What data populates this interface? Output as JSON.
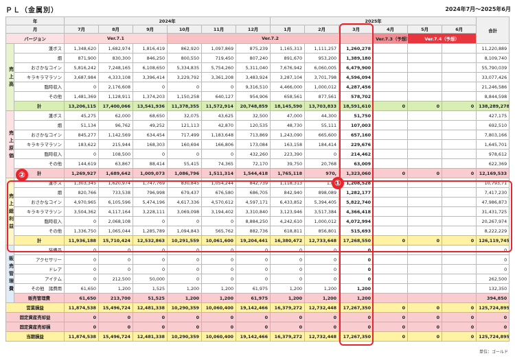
{
  "header": {
    "title": "ＰＬ（金属別）",
    "period": "2024年7月〜2025年6月"
  },
  "columns": {
    "nen_label": "年",
    "tsuki_label": "月",
    "version_label": "バージョン",
    "total_label": "合計",
    "years": [
      {
        "label": "2024年",
        "span": 6
      },
      {
        "label": "2025年",
        "span": 6
      }
    ],
    "months": [
      "7月",
      "8月",
      "9月",
      "10月",
      "11月",
      "12月",
      "1月",
      "2月",
      "3月",
      "4月",
      "5月",
      "6月"
    ],
    "versions": [
      {
        "label": "Ver.7.1",
        "span": 3,
        "cls": "v71"
      },
      {
        "label": "Ver.7.2",
        "span": 6,
        "cls": "v72"
      },
      {
        "label": "Ver.7.3（予想）",
        "span": 1,
        "cls": "v73"
      },
      {
        "label": "Ver.7.4（予想）",
        "span": 2,
        "cls": "v74"
      }
    ]
  },
  "sections": [
    {
      "label": "売上高",
      "style": "g-blk",
      "rows": [
        {
          "name": "蓬ボス",
          "values": [
            "1,348,620",
            "1,682,974",
            "1,816,419",
            "862,920",
            "1,097,869",
            "875,239",
            "1,165,313",
            "1,111,257",
            "1,260,278",
            "",
            "",
            ""
          ],
          "total": "11,220,889"
        },
        {
          "name": "烟",
          "values": [
            "871,900",
            "830,300",
            "846,250",
            "800,550",
            "719,450",
            "807,240",
            "891,670",
            "953,200",
            "1,389,180",
            "",
            "",
            ""
          ],
          "total": "8,109,740"
        },
        {
          "name": "おさかなコイン",
          "values": [
            "5,816,242",
            "7,248,165",
            "6,108,650",
            "5,334,835",
            "5,754,260",
            "5,311,040",
            "7,676,942",
            "6,060,005",
            "6,479,900",
            "",
            "",
            ""
          ],
          "total": "55,790,039"
        },
        {
          "name": "キラキラマラソン",
          "values": [
            "3,687,984",
            "4,333,108",
            "3,396,414",
            "3,229,792",
            "3,361,208",
            "3,483,924",
            "3,287,104",
            "3,701,798",
            "4,596,094",
            "",
            "",
            ""
          ],
          "total": "33,077,426"
        },
        {
          "name": "臨時収入",
          "values": [
            "0",
            "2,176,608",
            "0",
            "0",
            "0",
            "9,316,510",
            "4,466,000",
            "1,000,012",
            "4,287,456",
            "",
            "",
            ""
          ],
          "total": "21,246,586"
        },
        {
          "name": "その他",
          "values": [
            "1,481,369",
            "1,128,911",
            "1,374,203",
            "1,150,258",
            "640,127",
            "954,906",
            "658,561",
            "877,561",
            "578,702",
            "",
            "",
            ""
          ],
          "total": "8,844,598"
        }
      ],
      "total": {
        "name": "計",
        "values": [
          "13,206,115",
          "17,400,066",
          "13,541,936",
          "11,378,355",
          "11,572,914",
          "20,748,859",
          "18,145,590",
          "13,703,833",
          "18,591,610",
          "0",
          "0",
          "0"
        ],
        "total": "138,289,278"
      }
    },
    {
      "label": "売上原価",
      "style": "p-blk",
      "rows": [
        {
          "name": "蓬ボス",
          "values": [
            "45,275",
            "62,000",
            "68,650",
            "32,075",
            "43,625",
            "32,500",
            "47,000",
            "44,300",
            "51,750",
            "",
            "",
            ""
          ],
          "total": "427,175"
        },
        {
          "name": "烟",
          "values": [
            "51,134",
            "96,762",
            "49,252",
            "121,113",
            "42,870",
            "120,535",
            "48,730",
            "55,111",
            "107,003",
            "",
            "",
            ""
          ],
          "total": "692,510"
        },
        {
          "name": "おさかなコイン",
          "values": [
            "845,277",
            "1,142,569",
            "634,454",
            "717,499",
            "1,183,648",
            "713,869",
            "1,243,090",
            "665,600",
            "657,160",
            "",
            "",
            ""
          ],
          "total": "7,803,166"
        },
        {
          "name": "キラキラマラソン",
          "values": [
            "183,622",
            "215,944",
            "168,303",
            "160,694",
            "166,806",
            "173,084",
            "163,158",
            "184,414",
            "229,676",
            "",
            "",
            ""
          ],
          "total": "1,645,701"
        },
        {
          "name": "臨時収入",
          "values": [
            "0",
            "108,500",
            "0",
            "0",
            "0",
            "432,260",
            "223,390",
            "0",
            "214,462",
            "",
            "",
            ""
          ],
          "total": "978,612"
        },
        {
          "name": "その他",
          "values": [
            "144,619",
            "63,867",
            "88,414",
            "55,415",
            "74,365",
            "72,170",
            "39,750",
            "20,768",
            "63,009",
            "",
            "",
            ""
          ],
          "total": "622,369"
        }
      ],
      "total": {
        "name": "計",
        "values": [
          "1,269,927",
          "1,689,642",
          "1,009,073",
          "1,086,796",
          "1,511,314",
          "1,544,418",
          "1,765,118",
          "970,",
          "1,323,060",
          "0",
          "0",
          "0"
        ],
        "total": "12,169,533"
      }
    },
    {
      "label": "売上総利益",
      "style": "y-blk",
      "rows": [
        {
          "name": "蓬ボス",
          "values": [
            "1,303,345",
            "1,620,974",
            "1,747,769",
            "830,845",
            "1,054,244",
            "842,739",
            "1,118,313",
            "1,06",
            "1,208,528",
            "",
            "",
            ""
          ],
          "total": "10,793,71"
        },
        {
          "name": "烟",
          "values": [
            "820,766",
            "733,538",
            "796,998",
            "679,437",
            "676,580",
            "686,705",
            "842,940",
            "898,089",
            "1,282,177",
            "",
            "",
            ""
          ],
          "total": "7,417,230"
        },
        {
          "name": "おさかなコイン",
          "values": [
            "4,970,965",
            "6,105,596",
            "5,474,196",
            "4,617,336",
            "4,570,612",
            "4,597,171",
            "6,433,852",
            "5,394,405",
            "5,822,740",
            "",
            "",
            ""
          ],
          "total": "47,986,873"
        },
        {
          "name": "キラキラマラソン",
          "values": [
            "3,504,362",
            "4,117,164",
            "3,228,111",
            "3,069,098",
            "3,194,402",
            "3,310,840",
            "3,123,946",
            "3,517,384",
            "4,366,418",
            "",
            "",
            ""
          ],
          "total": "31,431,725"
        },
        {
          "name": "臨時収入",
          "values": [
            "0",
            "2,068,108",
            "0",
            "0",
            "0",
            "8,884,250",
            "4,242,610",
            "1,000,012",
            "4,072,994",
            "",
            "",
            ""
          ],
          "total": "20,267,974"
        },
        {
          "name": "その他",
          "values": [
            "1,336,750",
            "1,065,044",
            "1,285,789",
            "1,094,843",
            "565,762",
            "882,736",
            "618,811",
            "856,801",
            "515,693",
            "",
            "",
            ""
          ],
          "total": "8,222,229"
        }
      ],
      "total": {
        "name": "計",
        "values": [
          "11,936,188",
          "15,710,424",
          "12,532,863",
          "10,291,559",
          "10,061,600",
          "19,204,441",
          "16,380,472",
          "12,733,648",
          "17,268,550",
          "0",
          "0",
          "0"
        ],
        "total": "126,119,745"
      }
    },
    {
      "label": "販売管理費",
      "style": "b-blk",
      "rows": [
        {
          "name": "装備品",
          "values": [
            "0",
            "0",
            "0",
            "0",
            "0",
            "0",
            "0",
            "0",
            "0",
            "",
            "",
            ""
          ],
          "total": "0"
        },
        {
          "name": "アクセサリー",
          "values": [
            "0",
            "0",
            "0",
            "0",
            "0",
            "0",
            "0",
            "0",
            "0",
            "",
            "",
            ""
          ],
          "total": "0"
        },
        {
          "name": "ドレア",
          "values": [
            "0",
            "0",
            "0",
            "0",
            "0",
            "0",
            "0",
            "0",
            "0",
            "",
            "",
            ""
          ],
          "total": "0"
        },
        {
          "name": "アイテム",
          "values": [
            "0",
            "212,500",
            "50,000",
            "0",
            "0",
            "0",
            "0",
            "0",
            "0",
            "",
            "",
            ""
          ],
          "total": "262,500"
        },
        {
          "name": "その他　諸費用",
          "values": [
            "61,650",
            "1,200",
            "1,525",
            "1,200",
            "1,200",
            "61,975",
            "1,200",
            "1,200",
            "1,200",
            "",
            "",
            ""
          ],
          "total": "132,350"
        }
      ],
      "total": {
        "name": "販売管理費",
        "values": [
          "61,650",
          "213,700",
          "51,525",
          "1,200",
          "1,200",
          "61,975",
          "1,200",
          "1,200",
          "1,200",
          "",
          "",
          ""
        ],
        "total": "394,850"
      }
    }
  ],
  "summary_rows": [
    {
      "name": "営業損益",
      "cls": "t-op",
      "values": [
        "11,874,538",
        "15,496,724",
        "12,481,338",
        "10,290,359",
        "10,060,400",
        "19,142,466",
        "16,379,272",
        "12,732,448",
        "17,267,350",
        "0",
        "0",
        "0"
      ],
      "total": "125,724,895"
    },
    {
      "name": "固定資産売却益",
      "cls": "t-fx",
      "values": [
        "0",
        "0",
        "0",
        "0",
        "0",
        "0",
        "0",
        "0",
        "0",
        "0",
        "0",
        "0"
      ],
      "total": "0"
    },
    {
      "name": "固定資産売却損",
      "cls": "t-fx",
      "values": [
        "0",
        "0",
        "0",
        "0",
        "0",
        "0",
        "0",
        "0",
        "0",
        "0",
        "0",
        "0"
      ],
      "total": "0"
    },
    {
      "name": "当期損益",
      "cls": "t-net",
      "values": [
        "11,874,538",
        "15,496,724",
        "12,481,338",
        "10,290,359",
        "10,060,400",
        "19,142,466",
        "16,379,272",
        "12,732,448",
        "17,267,350",
        "0",
        "0",
        "0"
      ],
      "total": "125,724,895"
    }
  ],
  "callouts": {
    "one": "①",
    "two": "②"
  },
  "footer": {
    "unit_note": "単位：ゴールド"
  }
}
